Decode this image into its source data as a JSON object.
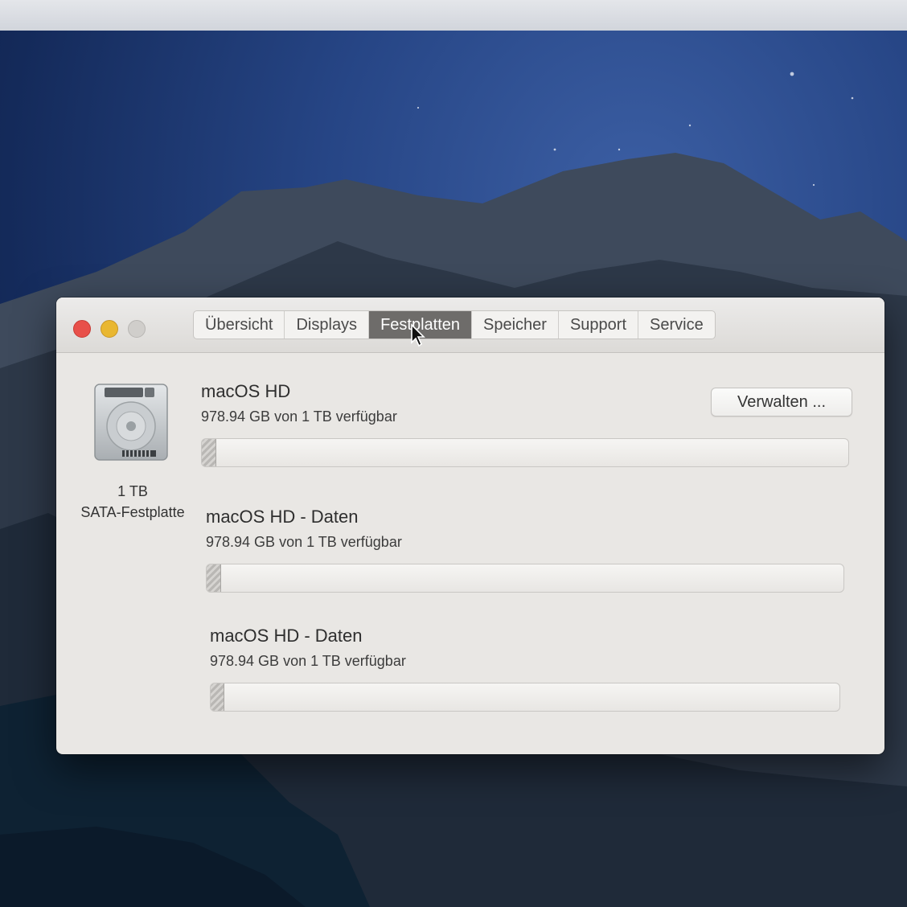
{
  "window": {
    "tabs": [
      {
        "label": "Übersicht"
      },
      {
        "label": "Displays"
      },
      {
        "label": "Festplatten"
      },
      {
        "label": "Speicher"
      },
      {
        "label": "Support"
      },
      {
        "label": "Service"
      }
    ],
    "active_tab": "Festplatten"
  },
  "disk": {
    "icon": "hard-drive-icon",
    "size": "1 TB",
    "type": "SATA-Festplatte"
  },
  "manage_button": {
    "label": "Verwalten ..."
  },
  "volumes": [
    {
      "name": "macOS HD",
      "info": "978.94 GB von 1 TB verfügbar",
      "used_fraction": 0.021
    },
    {
      "name": "macOS HD - Daten",
      "info": "978.94 GB von 1 TB verfügbar",
      "used_fraction": 0.021
    },
    {
      "name": "macOS HD - Daten",
      "info": "978.94 GB von 1 TB verfügbar",
      "used_fraction": 0.021
    }
  ],
  "colors": {
    "close": "#e8504a",
    "minimize": "#e9b731",
    "zoom": "#d0cecb",
    "active_tab": "#6e6c6a"
  }
}
